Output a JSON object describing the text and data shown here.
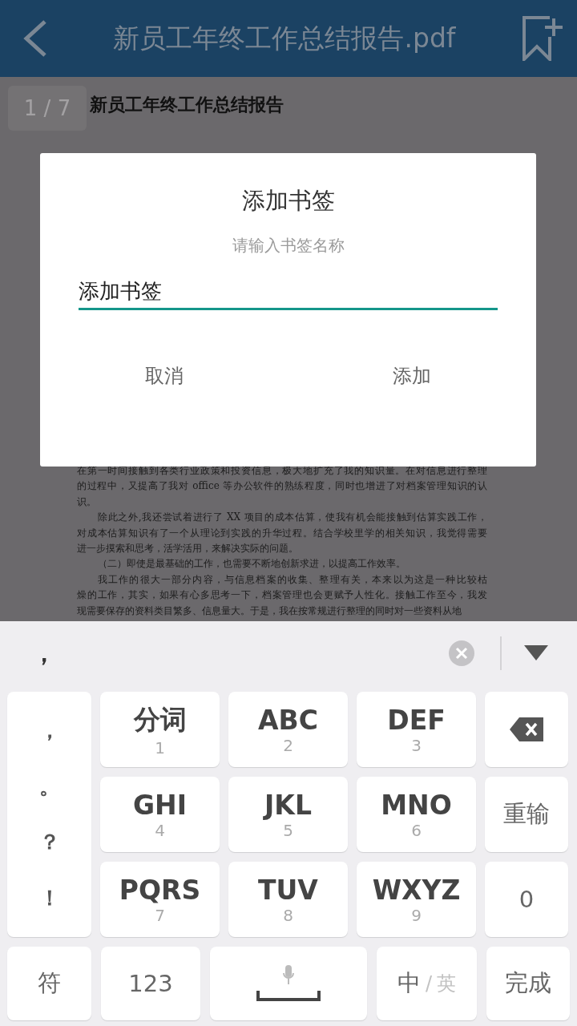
{
  "header": {
    "title": "新员工年终工作总结报告.pdf"
  },
  "document": {
    "page_indicator": "1 / 7",
    "title": "新员工年终工作总结报告",
    "paragraphs": [
      {
        "indent": false,
        "lines": [
          "在第一时间接触到各类行业政策和投资信息，极大地扩充了我的知识量。在对信息进行整理",
          "的过程中，又提高了我对 office 等办公软件的熟练程度，同时也增进了对档案管理知识的认",
          "识。"
        ]
      },
      {
        "indent": true,
        "lines": [
          "除此之外,我还尝试着进行了 XX 项目的成本估算，使我有机会能接触到估算实践工作，",
          "对成本估算知识有了一个从理论到实践的升华过程。结合学校里学的相关知识，我觉得需要",
          "进一步摸索和思考，活学活用，来解决实际的问题。"
        ]
      },
      {
        "indent": true,
        "lines": [
          "（二）即使是最基础的工作，也需要不断地创新求进，以提高工作效率。"
        ]
      },
      {
        "indent": true,
        "lines": [
          "我工作的很大一部分内容，与信息档案的收集、整理有关，本来以为这是一种比较枯",
          "燥的工作，其实，如果有心多思考一下，档案管理也会更赋予人性化。接触工作至今，我发",
          "现需要保存的资料类目繁多、信息量大。于是，我在按常规进行整理的同时对一些资料从地"
        ]
      }
    ]
  },
  "dialog": {
    "title": "添加书签",
    "subtitle": "请输入书签名称",
    "value": "添加书签",
    "buttons": [
      "取消",
      "添加"
    ]
  },
  "keyboard": {
    "candidate": "，",
    "symbols": [
      "，",
      "。",
      "？",
      "！"
    ],
    "keys": [
      {
        "kind": "t9",
        "label": "分词",
        "sub": "1"
      },
      {
        "kind": "t9",
        "label": "ABC",
        "sub": "2"
      },
      {
        "kind": "t9",
        "label": "DEF",
        "sub": "3"
      },
      {
        "kind": "delete"
      },
      {
        "kind": "t9",
        "label": "GHI",
        "sub": "4"
      },
      {
        "kind": "t9",
        "label": "JKL",
        "sub": "5"
      },
      {
        "kind": "t9",
        "label": "MNO",
        "sub": "6"
      },
      {
        "kind": "text",
        "label": "重输"
      },
      {
        "kind": "t9",
        "label": "PQRS",
        "sub": "7"
      },
      {
        "kind": "t9",
        "label": "TUV",
        "sub": "8"
      },
      {
        "kind": "t9",
        "label": "WXYZ",
        "sub": "9"
      },
      {
        "kind": "text",
        "label": "0"
      }
    ],
    "bottom": [
      {
        "kind": "text",
        "label": "符"
      },
      {
        "kind": "text",
        "label": "123"
      },
      {
        "kind": "space"
      },
      {
        "kind": "lang",
        "label": "中",
        "sep": "/",
        "alt": "英"
      },
      {
        "kind": "text",
        "label": "完成"
      }
    ]
  }
}
